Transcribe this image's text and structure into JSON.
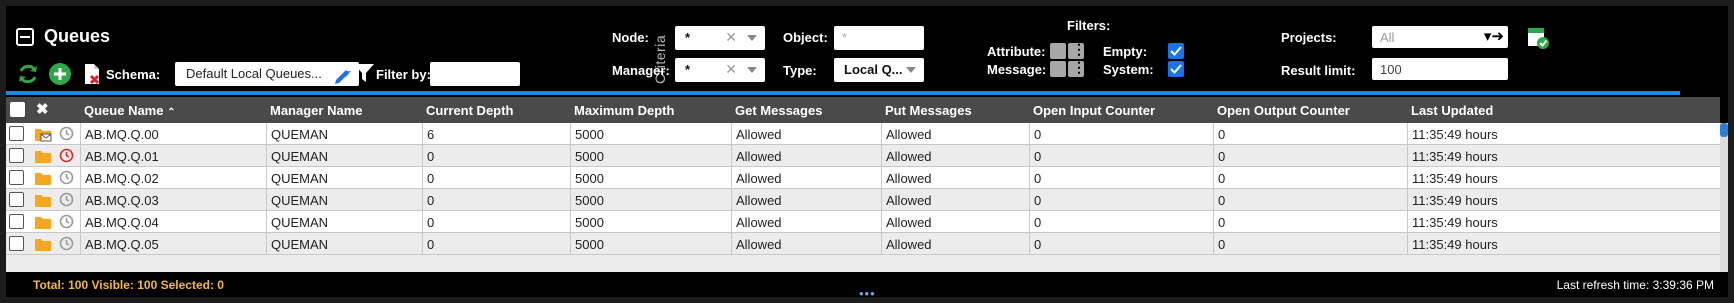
{
  "header": {
    "title": "Queues",
    "schema_label": "Schema:",
    "schema_value": "Default Local Queues...",
    "filter_by_label": "Filter by:",
    "filter_by_value": ""
  },
  "criteria": {
    "label": "Criteria",
    "node_label": "Node:",
    "node_value": "*",
    "manager_label": "Manager:",
    "manager_value": "*",
    "object_label": "Object:",
    "object_value": "*",
    "type_label": "Type:",
    "type_value": "Local Q..."
  },
  "filters": {
    "title": "Filters:",
    "attribute_label": "Attribute:",
    "message_label": "Message:",
    "empty_label": "Empty:",
    "empty_checked": true,
    "system_label": "System:",
    "system_checked": true
  },
  "projects": {
    "projects_label": "Projects:",
    "projects_value": "All",
    "result_limit_label": "Result limit:",
    "result_limit_value": "100"
  },
  "grid": {
    "columns": [
      "Queue Name",
      "Manager Name",
      "Current Depth",
      "Maximum Depth",
      "Get Messages",
      "Put Messages",
      "Open Input Counter",
      "Open Output Counter",
      "Last Updated"
    ],
    "sort_indicator": "⌃",
    "rows": [
      {
        "icon": "folder-mail-icon",
        "clock": "gray",
        "cells": [
          "AB.MQ.Q.00",
          "QUEMAN",
          "6",
          "5000",
          "Allowed",
          "Allowed",
          "0",
          "0",
          "11:35:49 hours"
        ]
      },
      {
        "icon": "folder-icon",
        "clock": "red",
        "cells": [
          "AB.MQ.Q.01",
          "QUEMAN",
          "0",
          "5000",
          "Allowed",
          "Allowed",
          "0",
          "0",
          "11:35:49 hours"
        ]
      },
      {
        "icon": "folder-icon",
        "clock": "gray",
        "cells": [
          "AB.MQ.Q.02",
          "QUEMAN",
          "0",
          "5000",
          "Allowed",
          "Allowed",
          "0",
          "0",
          "11:35:49 hours"
        ]
      },
      {
        "icon": "folder-icon",
        "clock": "gray",
        "cells": [
          "AB.MQ.Q.03",
          "QUEMAN",
          "0",
          "5000",
          "Allowed",
          "Allowed",
          "0",
          "0",
          "11:35:49 hours"
        ]
      },
      {
        "icon": "folder-icon",
        "clock": "gray",
        "cells": [
          "AB.MQ.Q.04",
          "QUEMAN",
          "0",
          "5000",
          "Allowed",
          "Allowed",
          "0",
          "0",
          "11:35:49 hours"
        ]
      },
      {
        "icon": "folder-icon",
        "clock": "gray",
        "cells": [
          "AB.MQ.Q.05",
          "QUEMAN",
          "0",
          "5000",
          "Allowed",
          "Allowed",
          "0",
          "0",
          "11:35:49 hours"
        ]
      }
    ]
  },
  "footer": {
    "status": "Total: 100 Visible: 100 Selected: 0",
    "last_refresh": "Last refresh time: 3:39:36 PM",
    "resize_handle": "•••"
  },
  "colors": {
    "accent_blue": "#1e88d8",
    "status_orange": "#f3b93a",
    "refresh_green": "#2ea84a",
    "folder_orange": "#f5a623",
    "clock_red": "#d32f2f"
  }
}
